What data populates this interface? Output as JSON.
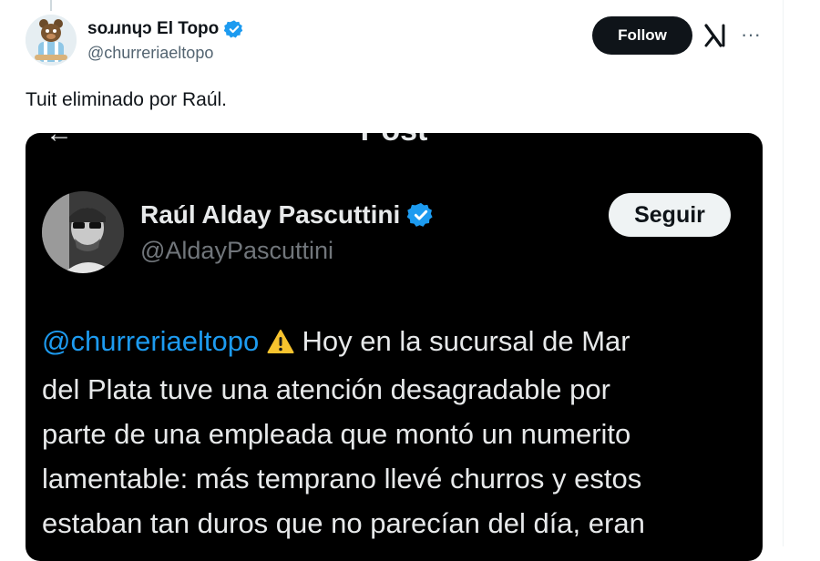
{
  "post": {
    "author_name": "soɹɹnɥɔ El Topo",
    "author_handle": "@churreriaeltopo",
    "follow_label": "Follow",
    "more_label": "···",
    "text": "Tuit eliminado por Raúl."
  },
  "embedded_post": {
    "header_title": "Post",
    "author_name": "Raúl Alday Pascuttini",
    "author_handle": "@AldayPascuttini",
    "follow_label": "Seguir",
    "mention": "@churreriaeltopo",
    "line1_rest": " Hoy en la sucursal de Mar",
    "lines": [
      "del Plata tuve una atención desagradable por",
      "parte de una empleada que montó un numerito",
      "lamentable: más temprano llevé churros y estos",
      "estaban tan duros que no parecían del día, eran"
    ]
  },
  "colors": {
    "verified": "#1d9bf0",
    "mention": "#1d9bf0",
    "warning": "#f7c32e"
  },
  "icons": [
    "verified-badge-icon",
    "x-logo-icon",
    "more-icon",
    "warning-icon",
    "back-arrow-icon"
  ]
}
